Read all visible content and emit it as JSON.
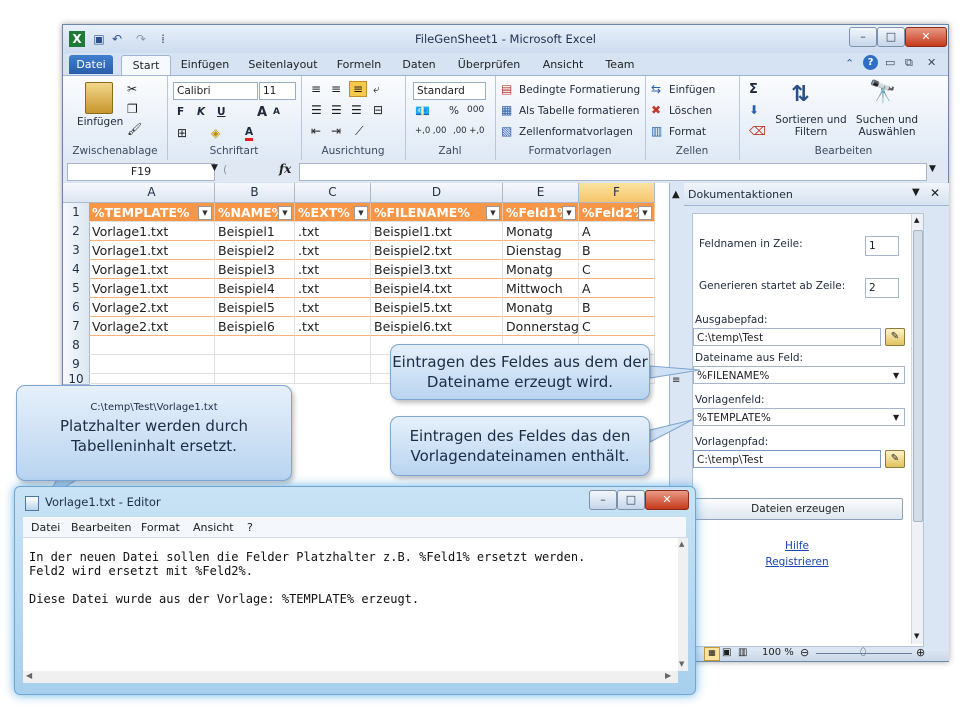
{
  "excel": {
    "title": "FileGenSheet1 - Microsoft Excel",
    "tabs": [
      "Datei",
      "Start",
      "Einfügen",
      "Seitenlayout",
      "Formeln",
      "Daten",
      "Überprüfen",
      "Ansicht",
      "Team"
    ],
    "groups": {
      "clipboard": {
        "label": "Zwischenablage",
        "paste": "Einfügen"
      },
      "font": {
        "label": "Schriftart",
        "family": "Calibri",
        "size": "11",
        "bold": "F",
        "italic": "K",
        "underline": "U",
        "grow": "A",
        "shrink": "A",
        "color": "A"
      },
      "align": {
        "label": "Ausrichtung"
      },
      "number": {
        "label": "Zahl",
        "format": "Standard",
        "percent": "%",
        "thousands": "000",
        "inc": "+,0 ,00",
        "dec": ",00 +,0"
      },
      "styles": {
        "label": "Formatvorlagen",
        "items": [
          "Bedingte Formatierung",
          "Als Tabelle formatieren",
          "Zellenformatvorlagen"
        ]
      },
      "cells": {
        "label": "Zellen",
        "items": [
          "Einfügen",
          "Löschen",
          "Format"
        ]
      },
      "edit": {
        "label": "Bearbeiten",
        "sum": "Σ",
        "sort": "Sortieren und Filtern",
        "find": "Suchen und Auswählen"
      }
    },
    "namebox": "F19",
    "fx": "fx",
    "columns": [
      "A",
      "B",
      "C",
      "D",
      "E",
      "F"
    ],
    "rows": [
      "1",
      "2",
      "3",
      "4",
      "5",
      "6",
      "7",
      "8",
      "9",
      "10"
    ],
    "headers": [
      "%TEMPLATE%",
      "%NAME%",
      "%EXT%",
      "%FILENAME%",
      "%Feld1%",
      "%Feld2%"
    ],
    "data": [
      [
        "Vorlage1.txt",
        "Beispiel1",
        ".txt",
        "Beispiel1.txt",
        "Monatg",
        "A"
      ],
      [
        "Vorlage1.txt",
        "Beispiel2",
        ".txt",
        "Beispiel2.txt",
        "Dienstag",
        "B"
      ],
      [
        "Vorlage1.txt",
        "Beispiel3",
        ".txt",
        "Beispiel3.txt",
        "Monatg",
        "C"
      ],
      [
        "Vorlage1.txt",
        "Beispiel4",
        ".txt",
        "Beispiel4.txt",
        "Mittwoch",
        "A"
      ],
      [
        "Vorlage2.txt",
        "Beispiel5",
        ".txt",
        "Beispiel5.txt",
        "Monatg",
        "B"
      ],
      [
        "Vorlage2.txt",
        "Beispiel6",
        ".txt",
        "Beispiel6.txt",
        "Donnerstag",
        "C"
      ]
    ],
    "zoom": "100 %"
  },
  "pane": {
    "title": "Dokumentaktionen",
    "feldnamen_label": "Feldnamen in Zeile:",
    "feldnamen_value": "1",
    "start_label": "Generieren startet ab Zeile:",
    "start_value": "2",
    "ausgabe_label": "Ausgabepfad:",
    "ausgabe_value": "C:\\temp\\Test",
    "dateiname_label": "Dateiname aus Feld:",
    "dateiname_value": "%FILENAME%",
    "vorlagenfeld_label": "Vorlagenfeld:",
    "vorlagenfeld_value": "%TEMPLATE%",
    "vorlagenpfad_label": "Vorlagenpfad:",
    "vorlagenpfad_value": "C:\\temp\\Test",
    "button": "Dateien erzeugen",
    "help": "Hilfe",
    "register": "Registrieren"
  },
  "callouts": {
    "c1": "Eintragen des Feldes aus dem der Dateiname erzeugt wird.",
    "c2": "Eintragen des Feldes das den Vorlagendateinamen enthält.",
    "c3_path": "C:\\temp\\Test\\Vorlage1.txt",
    "c3_text": "Platzhalter werden durch Tabelleninhalt ersetzt."
  },
  "notepad": {
    "title": "Vorlage1.txt - Editor",
    "menu": [
      "Datei",
      "Bearbeiten",
      "Format",
      "Ansicht",
      "?"
    ],
    "text": "In der neuen Datei sollen die Felder Platzhalter z.B. %Feld1% ersetzt werden.\nFeld2 wird ersetzt mit %Feld2%.\n\nDiese Datei wurde aus der Vorlage: %TEMPLATE% erzeugt."
  },
  "colors": {
    "accent": "#f79646",
    "ribbon": "#dfe9f5",
    "callout": "#b9d4f0"
  }
}
